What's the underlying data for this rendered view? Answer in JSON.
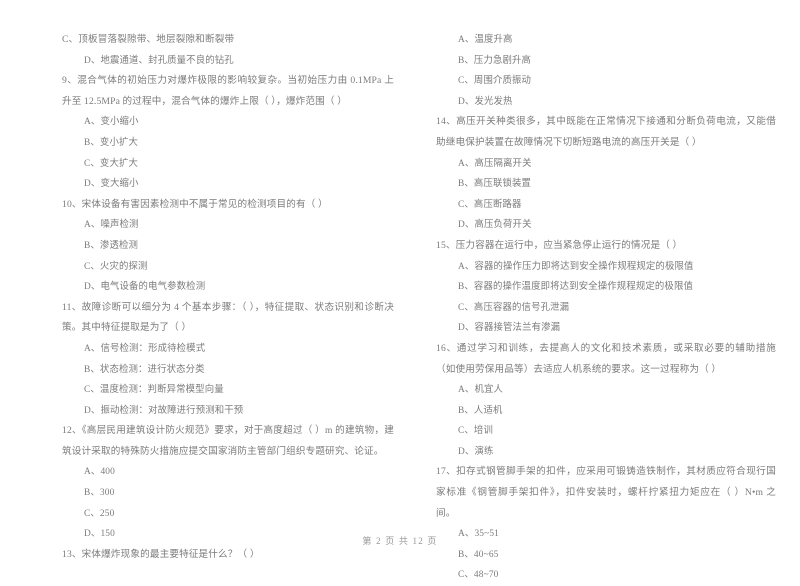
{
  "document": {
    "type": "exam-paper",
    "footer": "第 2 页 共 12 页"
  },
  "left_column": {
    "items": [
      {
        "kind": "option",
        "text": "C、顶板冒落裂隙带、地层裂隙和断裂带"
      },
      {
        "kind": "option",
        "text": "D、地震通道、封孔质量不良的钻孔"
      },
      {
        "kind": "stem",
        "text": "9、混合气体的初始压力对爆炸极限的影响较复杂。当初始压力由 0.1MPa 上升至 12.5MPa 的过程中，混合气体的爆炸上限（      ），爆炸范围（      ）"
      },
      {
        "kind": "option",
        "text": "A、变小缩小"
      },
      {
        "kind": "option",
        "text": "B、变小扩大"
      },
      {
        "kind": "option",
        "text": "C、变大扩大"
      },
      {
        "kind": "option",
        "text": "D、变大缩小"
      },
      {
        "kind": "stem",
        "text": "10、宋体设备有害因素检测中不属于常见的检测项目的有（      ）"
      },
      {
        "kind": "option",
        "text": "A、噪声检测"
      },
      {
        "kind": "option",
        "text": "B、渗透检测"
      },
      {
        "kind": "option",
        "text": "C、火灾的探测"
      },
      {
        "kind": "option",
        "text": "D、电气设备的电气参数检测"
      },
      {
        "kind": "stem",
        "text": "11、故障诊断可以细分为 4 个基本步骤：（      ），特征提取、状态识别和诊断决策。其中特征提取是为了（      ）"
      },
      {
        "kind": "option",
        "text": "A、信号检测：形成待检模式"
      },
      {
        "kind": "option",
        "text": "B、状态检测：进行状态分类"
      },
      {
        "kind": "option",
        "text": "C、温度检测：判断异常模型向量"
      },
      {
        "kind": "option",
        "text": "D、振动检测：对故障进行预测和干预"
      },
      {
        "kind": "stem",
        "text": "12、《高层民用建筑设计防火规范》要求，对于高度超过（      ）m 的建筑物，建筑设计采取的特殊防火措施应提交国家消防主管部门组织专题研究、论证。"
      },
      {
        "kind": "option",
        "text": "A、400"
      },
      {
        "kind": "option",
        "text": "B、300"
      },
      {
        "kind": "option",
        "text": "C、250"
      },
      {
        "kind": "option",
        "text": "D、150"
      },
      {
        "kind": "stem",
        "text": "13、宋体爆炸现象的最主要特征是什么？（      ）"
      }
    ]
  },
  "right_column": {
    "items": [
      {
        "kind": "option",
        "text": "A、温度升高"
      },
      {
        "kind": "option",
        "text": "B、压力急剧升高"
      },
      {
        "kind": "option",
        "text": "C、周围介质振动"
      },
      {
        "kind": "option",
        "text": "D、发光发热"
      },
      {
        "kind": "stem",
        "text": "14、高压开关种类很多，其中既能在正常情况下接通和分断负荷电流，又能借助继电保护装置在故障情况下切断短路电流的高压开关是（      ）"
      },
      {
        "kind": "option",
        "text": "A、高压隔离开关"
      },
      {
        "kind": "option",
        "text": "B、高压联锁装置"
      },
      {
        "kind": "option",
        "text": "C、高压断路器"
      },
      {
        "kind": "option",
        "text": "D、高压负荷开关"
      },
      {
        "kind": "stem",
        "text": "15、压力容器在运行中，应当紧急停止运行的情况是（      ）"
      },
      {
        "kind": "option",
        "text": "A、容器的操作压力即将达到安全操作规程规定的极限值"
      },
      {
        "kind": "option",
        "text": "B、容器的操作温度即将达到安全操作规程规定的极限值"
      },
      {
        "kind": "option",
        "text": "C、高压容器的信号孔泄漏"
      },
      {
        "kind": "option",
        "text": "D、容器接管法兰有渗漏"
      },
      {
        "kind": "stem",
        "text": "16、通过学习和训练，去提高人的文化和技术素质，或采取必要的辅助措施（如使用劳保用品等）去适应人机系统的要求。这一过程称为（      ）"
      },
      {
        "kind": "option",
        "text": "A、机宜人"
      },
      {
        "kind": "option",
        "text": "B、人适机"
      },
      {
        "kind": "option",
        "text": "C、培训"
      },
      {
        "kind": "option",
        "text": "D、演练"
      },
      {
        "kind": "stem",
        "text": "17、扣存式钢管脚手架的扣件，应采用可锻铸造铁制作，其材质应符合现行国家标准《钢管脚手架扣件》，扣件安装时，螺杆拧紧扭力矩应在（      ）N•m 之间。"
      },
      {
        "kind": "option",
        "text": "A、35~51"
      },
      {
        "kind": "option",
        "text": "B、40~65"
      },
      {
        "kind": "option",
        "text": "C、48~70"
      }
    ]
  }
}
